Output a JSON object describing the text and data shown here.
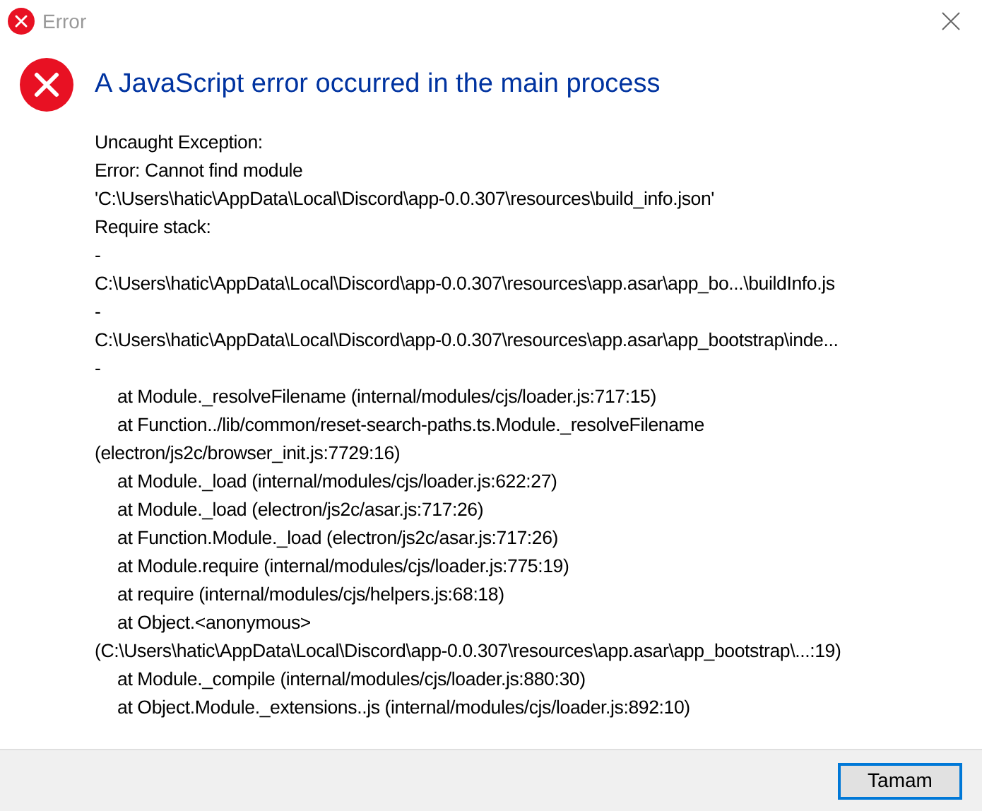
{
  "window": {
    "title": "Error"
  },
  "heading": "A JavaScript error occurred in the main process",
  "message_lines": [
    {
      "kind": "text",
      "text": "Uncaught Exception:"
    },
    {
      "kind": "text",
      "text": "Error: Cannot find module"
    },
    {
      "kind": "text",
      "text": "'C:\\Users\\hatic\\AppData\\Local\\Discord\\app-0.0.307\\resources\\build_info.json'"
    },
    {
      "kind": "text",
      "text": "Require stack:"
    },
    {
      "kind": "text",
      "text": "-"
    },
    {
      "kind": "text",
      "text": "C:\\Users\\hatic\\AppData\\Local\\Discord\\app-0.0.307\\resources\\app.asar\\app_bo...\\buildInfo.js"
    },
    {
      "kind": "text",
      "text": "-"
    },
    {
      "kind": "text",
      "text": "C:\\Users\\hatic\\AppData\\Local\\Discord\\app-0.0.307\\resources\\app.asar\\app_bootstrap\\inde..."
    },
    {
      "kind": "text",
      "text": "-"
    },
    {
      "kind": "frame",
      "text": "at Module._resolveFilename (internal/modules/cjs/loader.js:717:15)"
    },
    {
      "kind": "frame",
      "text": "at Function../lib/common/reset-search-paths.ts.Module._resolveFilename"
    },
    {
      "kind": "text",
      "text": "(electron/js2c/browser_init.js:7729:16)"
    },
    {
      "kind": "frame",
      "text": "at Module._load (internal/modules/cjs/loader.js:622:27)"
    },
    {
      "kind": "frame",
      "text": "at Module._load (electron/js2c/asar.js:717:26)"
    },
    {
      "kind": "frame",
      "text": "at Function.Module._load (electron/js2c/asar.js:717:26)"
    },
    {
      "kind": "frame",
      "text": "at Module.require (internal/modules/cjs/loader.js:775:19)"
    },
    {
      "kind": "frame",
      "text": "at require (internal/modules/cjs/helpers.js:68:18)"
    },
    {
      "kind": "frame",
      "text": "at Object.<anonymous>"
    },
    {
      "kind": "text",
      "text": "(C:\\Users\\hatic\\AppData\\Local\\Discord\\app-0.0.307\\resources\\app.asar\\app_bootstrap\\...:19)"
    },
    {
      "kind": "frame",
      "text": "at Module._compile (internal/modules/cjs/loader.js:880:30)"
    },
    {
      "kind": "frame",
      "text": "at Object.Module._extensions..js (internal/modules/cjs/loader.js:892:10)"
    }
  ],
  "buttons": [
    {
      "label": "Tamam",
      "selected": true
    }
  ]
}
